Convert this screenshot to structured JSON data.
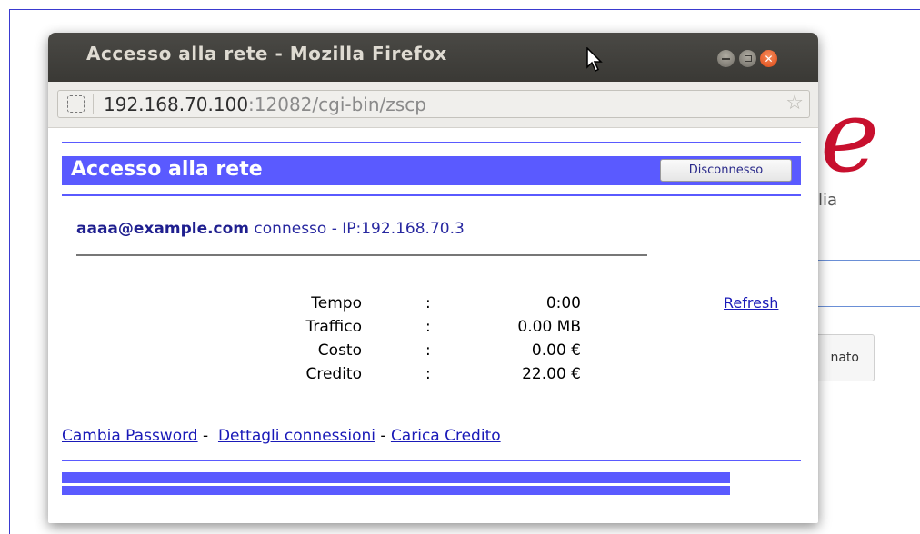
{
  "background": {
    "logo_letter": "e",
    "subtitle_fragment": "lia",
    "button_fragment": "nato"
  },
  "window": {
    "title": "Accesso alla rete - Mozilla Firefox",
    "controls": {
      "minimize": "minimize-icon",
      "maximize": "maximize-icon",
      "close": "close-icon"
    }
  },
  "urlbar": {
    "host": "192.168.70.100",
    "rest": ":12082/cgi-bin/zscp",
    "star_icon": "bookmark-star-icon"
  },
  "page": {
    "header_title": "Accesso alla rete",
    "disconnect_label": "Disconnesso",
    "user_email": "aaaa@example.com",
    "user_status": " connesso - IP:192.168.70.3",
    "stats": [
      {
        "label": "Tempo",
        "colon": ":",
        "value": "0:00"
      },
      {
        "label": "Traffico",
        "colon": ":",
        "value": "0.00 MB"
      },
      {
        "label": "Costo",
        "colon": ":",
        "value": "0.00 €"
      },
      {
        "label": "Credito",
        "colon": ":",
        "value": "22.00 €"
      }
    ],
    "refresh_label": "Refresh",
    "links": {
      "change_password": "Cambia Password",
      "sep1": " - ",
      "connection_details": "Dettagli connessioni",
      "sep2": " - ",
      "load_credit": "Carica Credito"
    }
  },
  "colors": {
    "accent": "#5a5aff",
    "link": "#1a1ab8",
    "titlebar": "#3c3b37",
    "close_button": "#e5531a"
  }
}
